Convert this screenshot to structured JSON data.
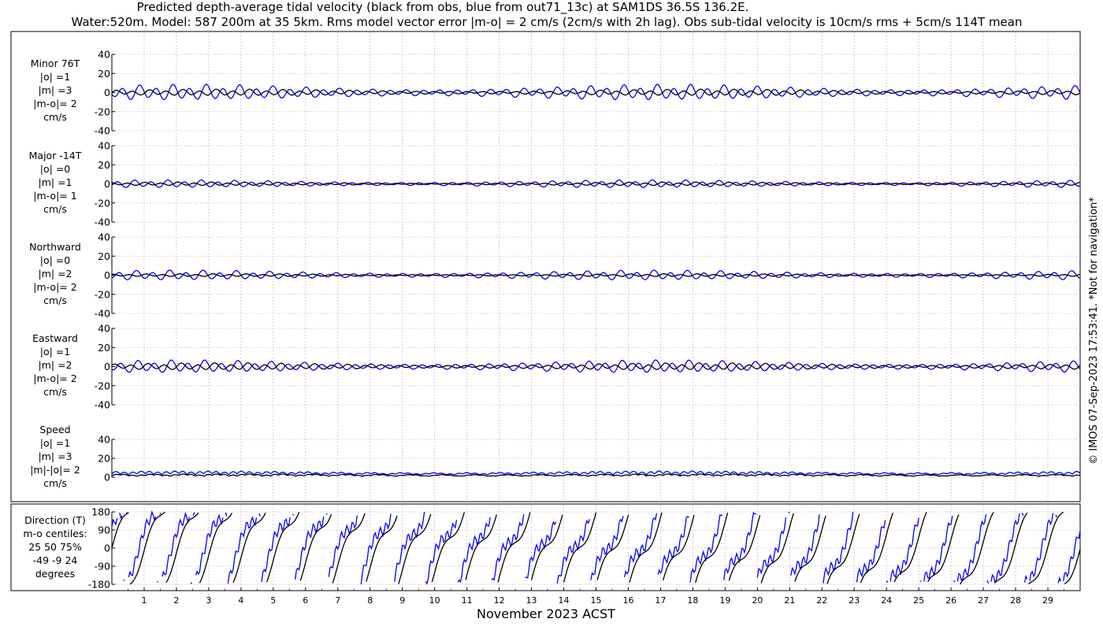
{
  "header": {
    "title_line1": "Predicted depth-average tidal velocity (black from obs, blue from out71_13c) at SAM1DS 36.5S 136.2E.",
    "title_line2": "Water:520m. Model: 587 200m at 35 5km. Rms model vector error |m-o| = 2 cm/s (2cm/s with 2h lag). Obs sub-tidal velocity is 10cm/s rms + 5cm/s 114T mean"
  },
  "footer": {
    "xlabel": "November 2023 ACST",
    "side_note": "© IMOS 07-Sep-2023 17:53:41. *Not for navigation*"
  },
  "legend": {
    "obs_color": "#000000",
    "model_color": "#0000ff",
    "obs_source": "obs",
    "model_source": "out71_13c"
  },
  "chart_data": [
    {
      "type": "line",
      "panel": "minor",
      "labels": [
        "Minor 76T",
        "|o| =1",
        "|m| =3",
        "|m-o|= 2",
        "cm/s"
      ],
      "ylim": [
        -40,
        40
      ],
      "yticks": [
        -40,
        -20,
        0,
        20,
        40
      ],
      "x_range_days": [
        0,
        30
      ],
      "series": [
        {
          "source": "obs",
          "amplitude": 1.8,
          "semidiurnal_phase": 0.0
        },
        {
          "source": "model",
          "amplitude": 4.5,
          "semidiurnal_phase": 0.6
        }
      ]
    },
    {
      "type": "line",
      "panel": "major",
      "labels": [
        "Major -14T",
        "|o| =0",
        "|m| =1",
        "|m-o|= 1",
        "cm/s"
      ],
      "ylim": [
        -40,
        40
      ],
      "yticks": [
        -40,
        -20,
        0,
        20,
        40
      ],
      "x_range_days": [
        0,
        30
      ],
      "series": [
        {
          "source": "obs",
          "amplitude": 1.0,
          "semidiurnal_phase": 0.3
        },
        {
          "source": "model",
          "amplitude": 2.2,
          "semidiurnal_phase": 0.9
        }
      ]
    },
    {
      "type": "line",
      "panel": "northward",
      "labels": [
        "Northward",
        "|o| =0",
        "|m| =2",
        "|m-o|= 2",
        "cm/s"
      ],
      "ylim": [
        -40,
        40
      ],
      "yticks": [
        -40,
        -20,
        0,
        20,
        40
      ],
      "x_range_days": [
        0,
        30
      ],
      "series": [
        {
          "source": "obs",
          "amplitude": 0.8,
          "semidiurnal_phase": 0.2
        },
        {
          "source": "model",
          "amplitude": 2.8,
          "semidiurnal_phase": 0.8
        }
      ]
    },
    {
      "type": "line",
      "panel": "eastward",
      "labels": [
        "Eastward",
        "|o| =1",
        "|m| =2",
        "|m-o|= 2",
        "cm/s"
      ],
      "ylim": [
        -40,
        40
      ],
      "yticks": [
        -40,
        -20,
        0,
        20,
        40
      ],
      "x_range_days": [
        0,
        30
      ],
      "series": [
        {
          "source": "obs",
          "amplitude": 2.0,
          "semidiurnal_phase": 0.1
        },
        {
          "source": "model",
          "amplitude": 3.6,
          "semidiurnal_phase": 0.7
        }
      ]
    },
    {
      "type": "line",
      "panel": "speed",
      "labels": [
        "Speed",
        "|o| =1",
        "|m| =3",
        "|m|-|o|= 2",
        "cm/s"
      ],
      "ylim": [
        0,
        40
      ],
      "yticks": [
        0,
        20,
        40
      ],
      "x_range_days": [
        0,
        30
      ],
      "series": [
        {
          "source": "obs",
          "amplitude": 1.5,
          "mean": 1.6,
          "semidiurnal_phase": 0.0
        },
        {
          "source": "model",
          "amplitude": 3.5,
          "mean": 3.0,
          "semidiurnal_phase": 0.5
        }
      ]
    },
    {
      "type": "line",
      "panel": "direction",
      "labels": [
        "Direction (T)",
        "m-o centiles:",
        "25  50  75%",
        "-49  -9  24",
        "degrees"
      ],
      "ylim": [
        -180,
        180
      ],
      "yticks": [
        -180,
        -90,
        0,
        90,
        180
      ],
      "x_range_days": [
        0,
        30
      ],
      "series": [
        {
          "source": "obs",
          "semidiurnal_phase": 0.0
        },
        {
          "source": "model",
          "semidiurnal_phase": 0.35
        }
      ]
    }
  ],
  "xaxis": {
    "day_ticks": [
      1,
      2,
      3,
      4,
      5,
      6,
      7,
      8,
      9,
      10,
      11,
      12,
      13,
      14,
      15,
      16,
      17,
      18,
      19,
      20,
      21,
      22,
      23,
      24,
      25,
      26,
      27,
      28,
      29
    ]
  }
}
